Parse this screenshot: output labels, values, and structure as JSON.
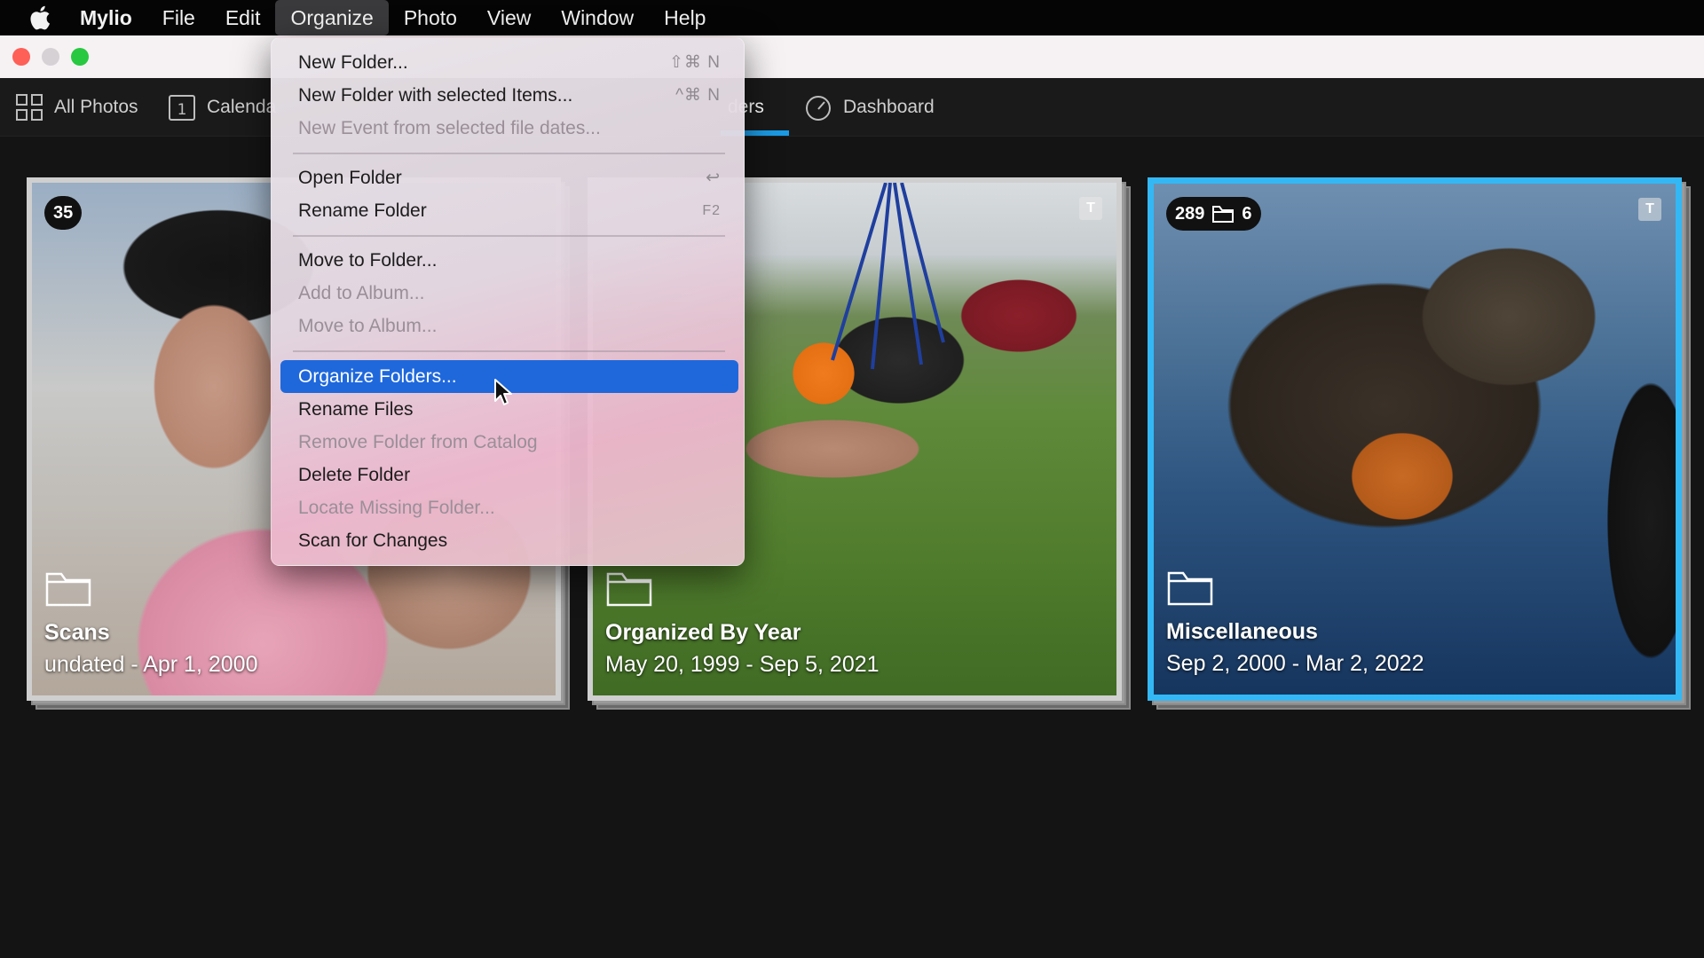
{
  "menubar": {
    "app": "Mylio",
    "items": [
      "File",
      "Edit",
      "Organize",
      "Photo",
      "View",
      "Window",
      "Help"
    ],
    "active": "Organize"
  },
  "toolbar": {
    "all_photos": "All Photos",
    "calendar": "Calenda",
    "calendar_day": "1",
    "folders_partial": "ders",
    "dashboard": "Dashboard"
  },
  "menu": {
    "new_folder": "New Folder...",
    "new_folder_sc": "⇧⌘ N",
    "new_folder_selected": "New Folder with selected Items...",
    "new_folder_selected_sc": "^⌘ N",
    "new_event": "New Event from selected file dates...",
    "open_folder": "Open Folder",
    "open_folder_sc": "↩",
    "rename_folder": "Rename Folder",
    "rename_folder_sc": "F2",
    "move_to_folder": "Move to Folder...",
    "add_to_album": "Add to Album...",
    "move_to_album": "Move to Album...",
    "organize_folders": "Organize Folders...",
    "rename_files": "Rename Files",
    "remove_folder": "Remove Folder from Catalog",
    "delete_folder": "Delete Folder",
    "locate_missing": "Locate Missing Folder...",
    "scan_changes": "Scan for Changes"
  },
  "cards": [
    {
      "count": "35",
      "title": "Scans",
      "dates": "undated - Apr 1, 2000"
    },
    {
      "title": "Organized By Year",
      "dates": "May 20, 1999 - Sep 5, 2021",
      "badge": "T"
    },
    {
      "count": "289",
      "subfolders": "6",
      "title": "Miscellaneous",
      "dates": "Sep 2, 2000 - Mar 2, 2022",
      "badge": "T"
    }
  ],
  "colors": {
    "accent": "#1a9be6",
    "highlight": "#1f68dc",
    "selected_border": "#33b8f5"
  }
}
